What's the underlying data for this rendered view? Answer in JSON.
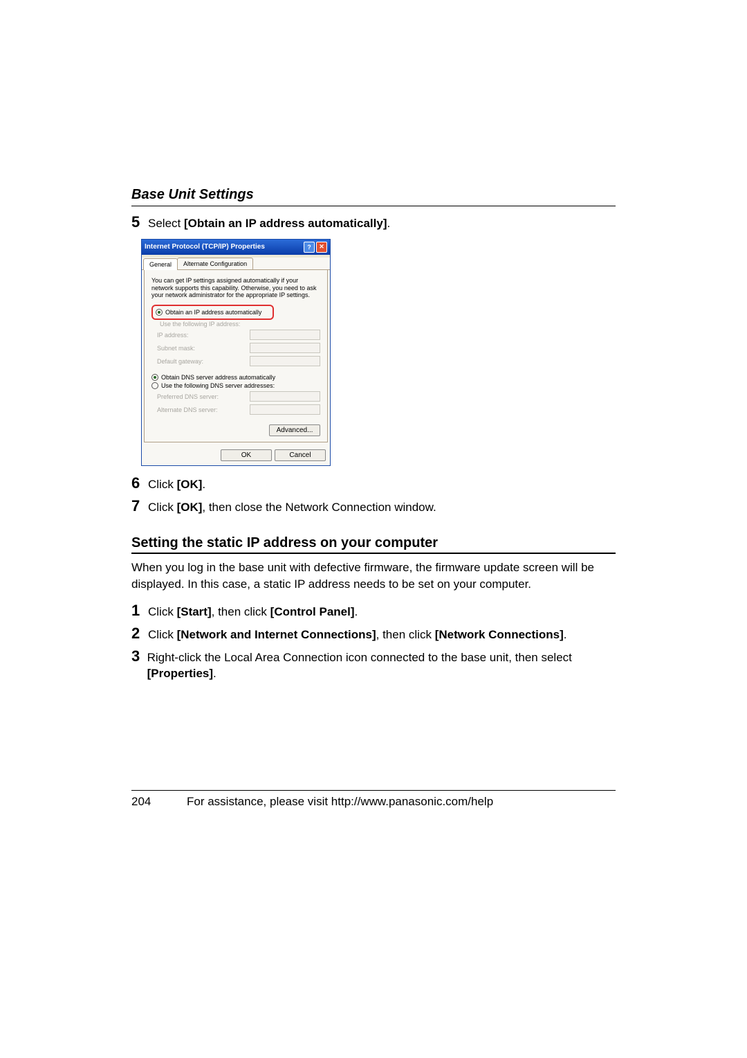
{
  "section_title": "Base Unit Settings",
  "step5": {
    "num": "5",
    "prefix": "Select ",
    "bold": "[Obtain an IP address automatically]",
    "suffix": "."
  },
  "dialog": {
    "title": "Internet Protocol (TCP/IP) Properties",
    "help": "?",
    "close": "✕",
    "tab_general": "General",
    "tab_alt": "Alternate Configuration",
    "description": "You can get IP settings assigned automatically if your network supports this capability. Otherwise, you need to ask your network administrator for the appropriate IP settings.",
    "radio_auto_ip": "Obtain an IP address automatically",
    "radio_manual_ip": "Use the following IP address:",
    "ip_label": "IP address:",
    "subnet_label": "Subnet mask:",
    "gateway_label": "Default gateway:",
    "radio_auto_dns": "Obtain DNS server address automatically",
    "radio_manual_dns": "Use the following DNS server addresses:",
    "pref_dns": "Preferred DNS server:",
    "alt_dns": "Alternate DNS server:",
    "advanced": "Advanced...",
    "ok": "OK",
    "cancel": "Cancel"
  },
  "step6": {
    "num": "6",
    "prefix": "Click ",
    "bold": "[OK]",
    "suffix": "."
  },
  "step7": {
    "num": "7",
    "prefix": "Click ",
    "bold": "[OK]",
    "suffix": ", then close the Network Connection window."
  },
  "subsection_title": "Setting the static IP address on your computer",
  "sub_para": "When you log in the base unit with defective firmware, the firmware update screen will be displayed. In this case, a static IP address needs to be set on your computer.",
  "s1": {
    "num": "1",
    "prefix": "Click ",
    "bold1": "[Start]",
    "mid": ", then click ",
    "bold2": "[Control Panel]",
    "suffix": "."
  },
  "s2": {
    "num": "2",
    "prefix": "Click ",
    "bold1": "[Network and Internet Connections]",
    "mid": ", then click ",
    "bold2": "[Network Connections]",
    "suffix": "."
  },
  "s3": {
    "num": "3",
    "text_before": "Right-click the Local Area Connection icon connected to the base unit, then select ",
    "bold": "[Properties]",
    "suffix": "."
  },
  "footer": {
    "page": "204",
    "assist": "For assistance, please visit http://www.panasonic.com/help"
  }
}
